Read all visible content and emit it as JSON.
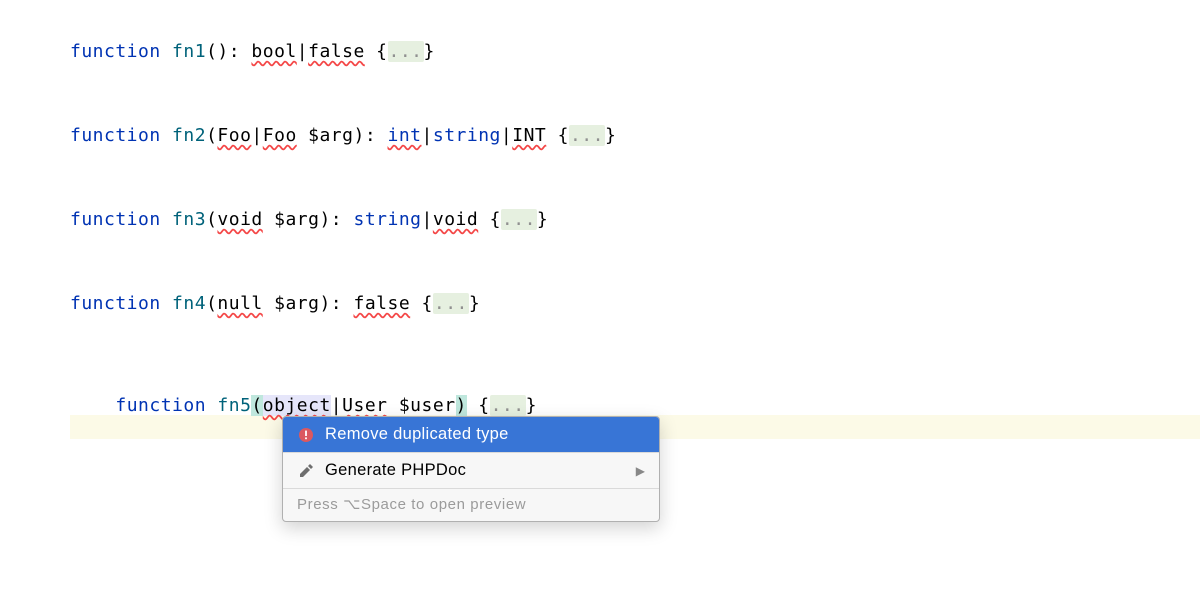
{
  "colors": {
    "keyword": "#0033B3",
    "functionName": "#00627A",
    "highlightLine": "#FCFAE7",
    "foldBg": "#E6F0E0",
    "selectionBg": "#E6E6FA",
    "caretBg": "#BFE7DD",
    "errorWave": "#F44747",
    "popupSelected": "#3875D6"
  },
  "tokens": {
    "kw_function": "function",
    "fold": "...",
    "arg_name": "$arg",
    "user_name": "$user",
    "pipe": "|"
  },
  "lines": {
    "l1": {
      "fn": "fn1",
      "ret1": "bool",
      "ret2": "false"
    },
    "l2": {
      "fn": "fn2",
      "p1": "Foo",
      "p2": "Foo",
      "ret1": "int",
      "ret2": "string",
      "ret3": "INT"
    },
    "l3": {
      "fn": "fn3",
      "p1": "void",
      "ret1": "string",
      "ret2": "void"
    },
    "l4": {
      "fn": "fn4",
      "p1": "null",
      "ret1": "false"
    },
    "l5": {
      "fn": "fn5",
      "p1": "object",
      "p2": "User"
    }
  },
  "popup": {
    "item1": "Remove duplicated type",
    "item2": "Generate PHPDoc",
    "hint": "Press ⌥Space to open preview",
    "icons": {
      "error": "error-circle-icon",
      "pencil": "pencil-icon",
      "arrow": "submenu-arrow-icon"
    }
  }
}
